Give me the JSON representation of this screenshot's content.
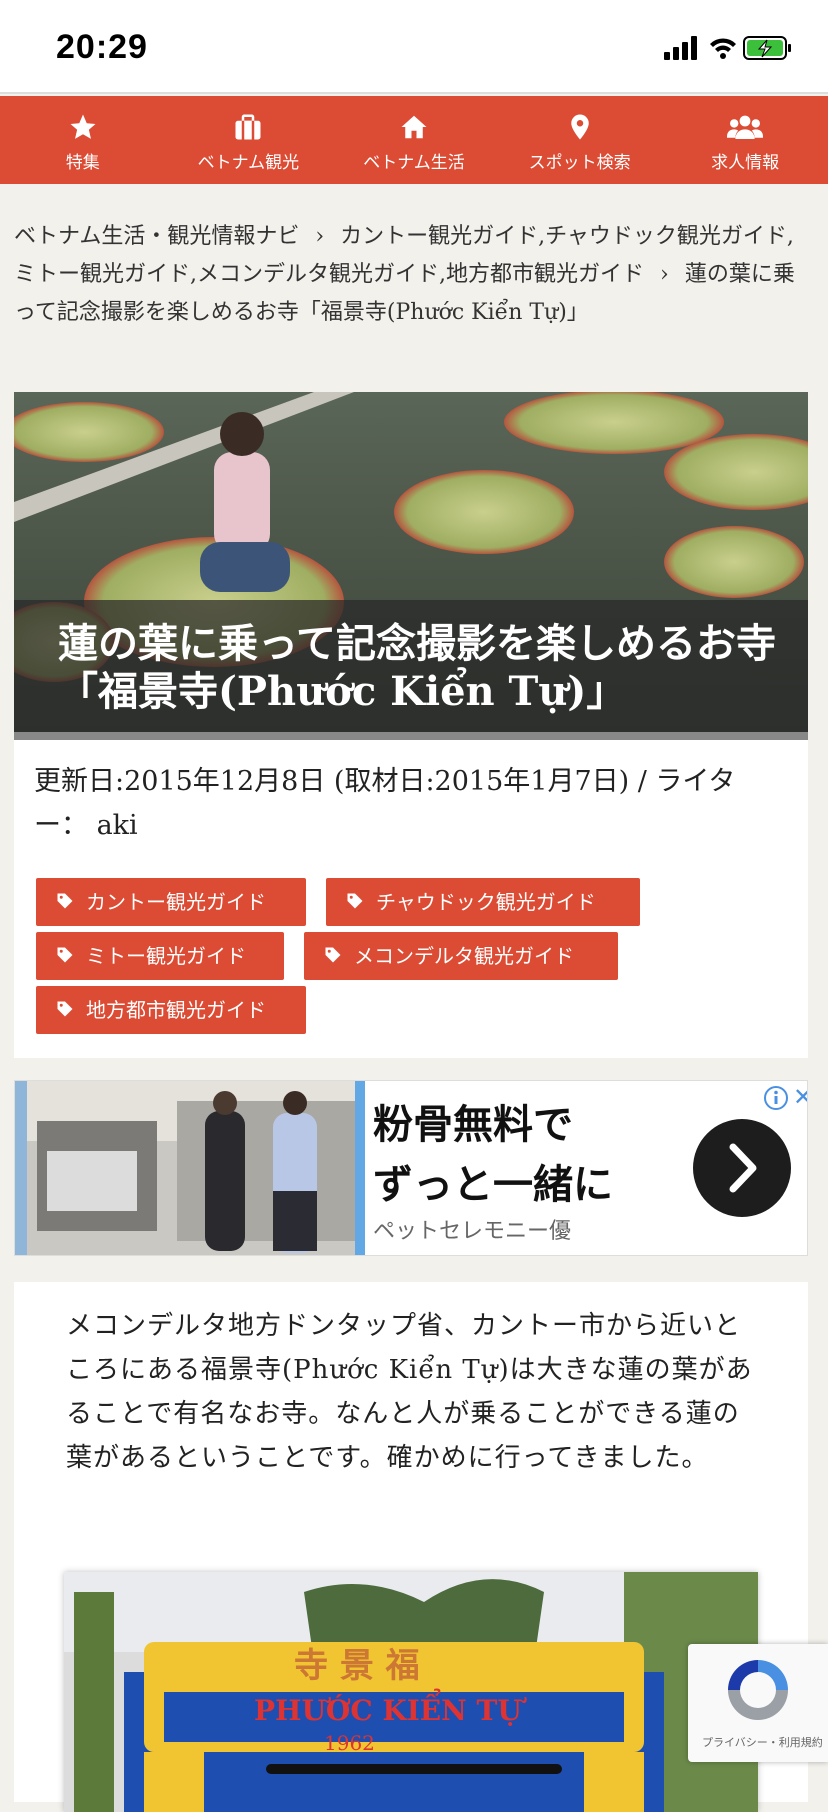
{
  "status_bar": {
    "time": "20:29"
  },
  "nav": {
    "items": [
      {
        "label": "特集",
        "icon": "star-icon"
      },
      {
        "label": "ベトナム観光",
        "icon": "suitcase-icon"
      },
      {
        "label": "ベトナム生活",
        "icon": "home-icon"
      },
      {
        "label": "スポット検索",
        "icon": "map-pin-icon"
      },
      {
        "label": "求人情報",
        "icon": "users-icon"
      }
    ],
    "color": "#dc4b33"
  },
  "breadcrumb": {
    "home": "ベトナム生活・観光情報ナビ",
    "category": "カントー観光ガイド,チャウドック観光ガイド,ミトー観光ガイド,メコンデルタ観光ガイド,地方都市観光ガイド",
    "current": "蓮の葉に乗って記念撮影を楽しめるお寺「福景寺(Phước Kiển Tự)」"
  },
  "hero": {
    "title": "蓮の葉に乗って記念撮影を楽しめるお寺「福景寺(Phước Kiển Tự)」"
  },
  "meta": {
    "text": "更新日:2015年12月8日 (取材日:2015年1月7日) / ライター： aki"
  },
  "tags": [
    "カントー観光ガイド",
    "チャウドック観光ガイド",
    "ミトー観光ガイド",
    "メコンデルタ観光ガイド",
    "地方都市観光ガイド"
  ],
  "ad": {
    "headline_line1": "粉骨無料で",
    "headline_line2": "ずっと一緒に",
    "sponsor": "ペットセレモニー優"
  },
  "article": {
    "intro": "メコンデルタ地方ドンタップ省、カントー市から近いところにある福景寺(Phước Kiển Tự)は大きな蓮の葉があることで有名なお寺。なんと人が乗ることができる蓮の葉があるということです。確かめに行ってきました。"
  },
  "recaptcha": {
    "text": "プライバシー・利用規約"
  }
}
